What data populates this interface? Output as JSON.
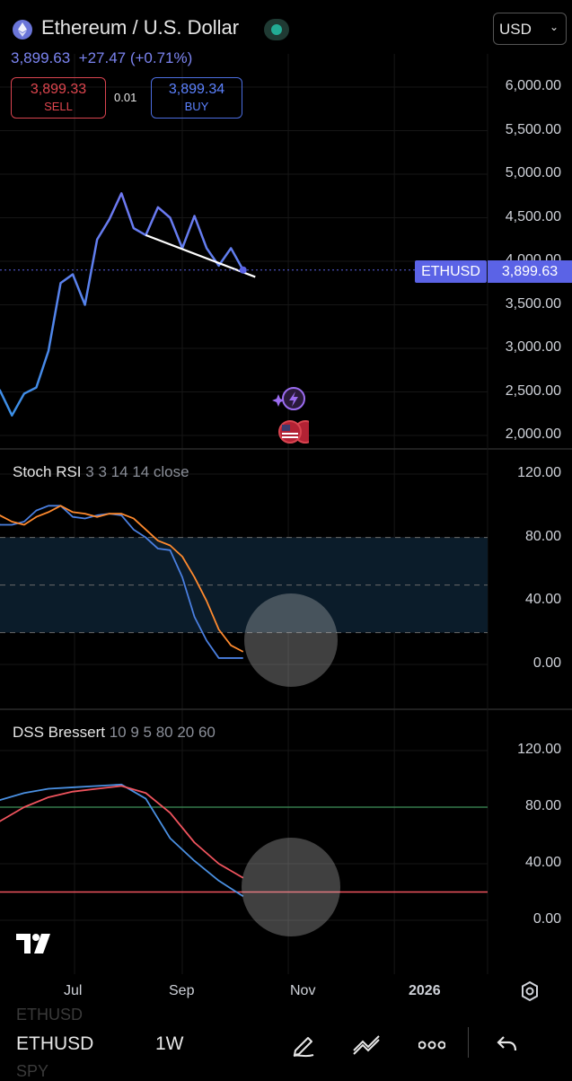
{
  "header": {
    "title": "Ethereum / U.S. Dollar",
    "currency": "USD",
    "last_price": "3,899.63",
    "change": "+27.47 (+0.71%)",
    "sell_price": "3,899.33",
    "sell_label": "SELL",
    "buy_price": "3,899.34",
    "buy_label": "BUY",
    "spread": "0.01"
  },
  "price_badge": {
    "symbol": "ETHUSD",
    "price": "3,899.63"
  },
  "x_labels": [
    "Jul",
    "Sep",
    "Nov",
    "2026"
  ],
  "colors": {
    "price_line": "#6f78f2",
    "stoch_k": "#4a7fe0",
    "stoch_d": "#ff8a2e",
    "dss_fast": "#4a90e2",
    "dss_slow": "#f0545e",
    "band_fill": "#0b1c2a",
    "accent": "#5b63e6",
    "sell": "#e0464f",
    "buy": "#5c82ff"
  },
  "chart_data": [
    {
      "type": "line",
      "name": "price",
      "ylim": [
        1900,
        6300
      ],
      "y_ticks": [
        "6,000.00",
        "5,500.00",
        "5,000.00",
        "4,500.00",
        "4,000.00",
        "3,500.00",
        "3,000.00",
        "2,500.00",
        "2,000.00"
      ],
      "y_tick_values": [
        6000,
        5500,
        5000,
        4500,
        4000,
        3500,
        3000,
        2500,
        2000
      ],
      "dates": [
        "2025-05-05",
        "2025-05-12",
        "2025-05-19",
        "2025-05-26",
        "2025-06-02",
        "2025-06-09",
        "2025-06-16",
        "2025-06-23",
        "2025-06-30",
        "2025-07-07",
        "2025-07-14",
        "2025-07-21",
        "2025-07-28",
        "2025-08-04",
        "2025-08-11",
        "2025-08-18",
        "2025-08-25",
        "2025-09-01",
        "2025-09-08",
        "2025-09-15",
        "2025-09-22",
        "2025-09-29",
        "2025-10-06",
        "2025-10-13",
        "2025-10-20",
        "2025-10-27"
      ],
      "values": [
        2550,
        2560,
        2520,
        2230,
        2480,
        2550,
        2970,
        3750,
        3850,
        3500,
        4250,
        4480,
        4780,
        4380,
        4300,
        4620,
        4500,
        4150,
        4520,
        4150,
        3950,
        4150,
        3899.63
      ],
      "value_dates": [
        "2025-05-05",
        "2025-05-12",
        "2025-05-19",
        "2025-05-26",
        "2025-06-02",
        "2025-06-09",
        "2025-06-16",
        "2025-06-23",
        "2025-06-30",
        "2025-07-07",
        "2025-07-14",
        "2025-07-21",
        "2025-07-28",
        "2025-08-04",
        "2025-08-11",
        "2025-08-18",
        "2025-08-25",
        "2025-09-01",
        "2025-09-08",
        "2025-09-15",
        "2025-09-22",
        "2025-09-29",
        "2025-10-06"
      ],
      "trendline": {
        "from": [
          "2025-08-11",
          4300
        ],
        "to": [
          "2025-10-13",
          3820
        ]
      },
      "current_price": 3899.63
    },
    {
      "type": "line",
      "name": "Stoch RSI",
      "title": "Stoch RSI",
      "params": "3 3 14 14 close",
      "ylim": [
        -15,
        130
      ],
      "y_ticks": [
        "120.00",
        "80.00",
        "40.00",
        "0.00"
      ],
      "y_tick_values": [
        120,
        80,
        40,
        0
      ],
      "band": [
        20,
        80
      ],
      "dates": [
        "2025-05-05",
        "2025-05-12",
        "2025-05-19",
        "2025-05-26",
        "2025-06-02",
        "2025-06-09",
        "2025-06-16",
        "2025-06-23",
        "2025-06-30",
        "2025-07-07",
        "2025-07-14",
        "2025-07-21",
        "2025-07-28",
        "2025-08-04",
        "2025-08-11",
        "2025-08-18",
        "2025-08-25",
        "2025-09-01",
        "2025-09-08",
        "2025-09-15",
        "2025-09-22",
        "2025-09-29",
        "2025-10-06"
      ],
      "series": [
        {
          "values": [
            99,
            99,
            88,
            88,
            90,
            97,
            100,
            100,
            93,
            92,
            94,
            95,
            94,
            85,
            80,
            73,
            72,
            55,
            30,
            15,
            4,
            4,
            4
          ]
        },
        {
          "values": [
            100,
            98,
            94,
            90,
            88,
            93,
            96,
            100,
            96,
            95,
            93,
            95,
            95,
            92,
            85,
            78,
            75,
            68,
            55,
            40,
            22,
            12,
            8
          ]
        }
      ]
    },
    {
      "type": "line",
      "name": "DSS Bressert",
      "title": "DSS Bressert",
      "params": "10 9 5 80 20 60",
      "ylim": [
        -15,
        130
      ],
      "y_ticks": [
        "120.00",
        "80.00",
        "40.00",
        "0.00"
      ],
      "y_tick_values": [
        120,
        80,
        40,
        0
      ],
      "levels": [
        80,
        20
      ],
      "dates": [
        "2025-05-05",
        "2025-05-19",
        "2025-06-02",
        "2025-06-16",
        "2025-06-30",
        "2025-07-14",
        "2025-07-28",
        "2025-08-11",
        "2025-08-25",
        "2025-09-08",
        "2025-09-22",
        "2025-10-06"
      ],
      "series": [
        {
          "values": [
            78,
            85,
            90,
            93,
            94,
            95,
            96,
            86,
            58,
            42,
            28,
            17
          ]
        },
        {
          "values": [
            57,
            70,
            80,
            87,
            91,
            93,
            95,
            90,
            76,
            55,
            40,
            30
          ]
        }
      ]
    }
  ],
  "footer": {
    "symbol": "ETHUSD",
    "timeframe": "1W",
    "ghost_above": "ETHUSD",
    "ghost_below": "SPY"
  }
}
